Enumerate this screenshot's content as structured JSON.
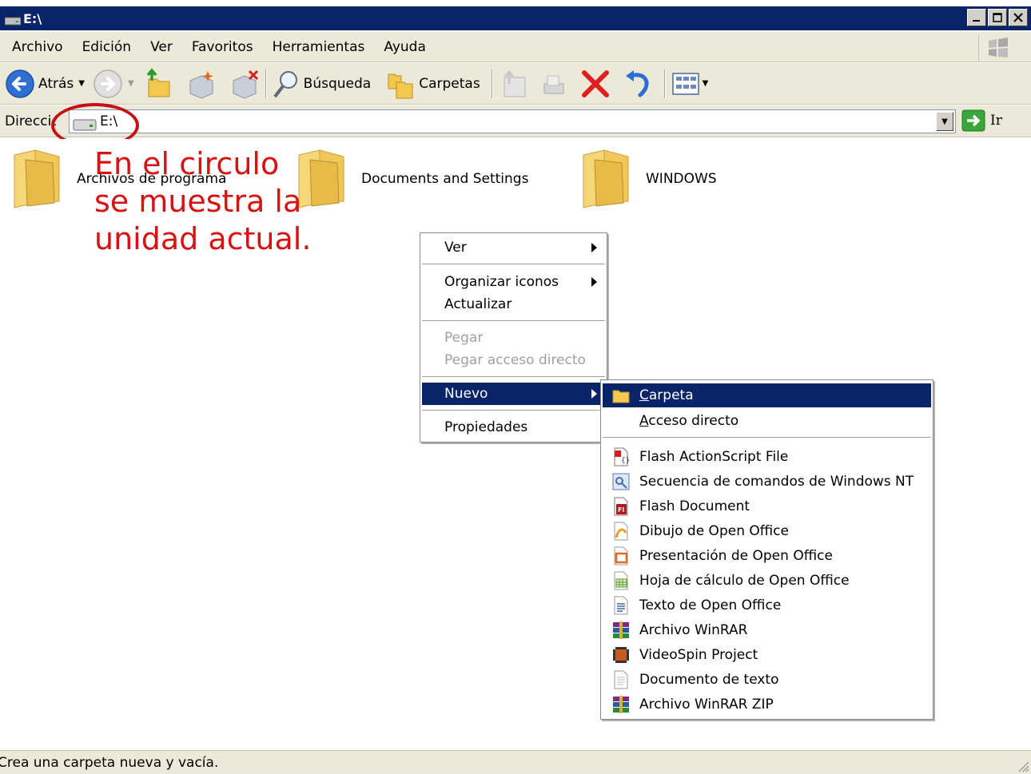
{
  "window": {
    "title": "E:\\"
  },
  "menubar": {
    "items": [
      "Archivo",
      "Edición",
      "Ver",
      "Favoritos",
      "Herramientas",
      "Ayuda"
    ]
  },
  "toolbar": {
    "back": "Atrás",
    "search": "Búsqueda",
    "folders": "Carpetas"
  },
  "address": {
    "label": "Dirección",
    "value": "E:\\",
    "go": "Ir"
  },
  "folders": [
    "Archivos de programa",
    "Documents and Settings",
    "WINDOWS"
  ],
  "annotation": {
    "lines": [
      "En el circulo",
      "se muestra la",
      "unidad actual."
    ]
  },
  "context_menu": {
    "items": [
      "Ver",
      "Organizar iconos",
      "Actualizar",
      "Pegar",
      "Pegar acceso directo",
      "Nuevo",
      "Propiedades"
    ]
  },
  "new_submenu": {
    "folder_prefix": "C",
    "folder_rest": "arpeta",
    "shortcut_prefix": "A",
    "shortcut_rest": "cceso directo",
    "items": [
      {
        "label": "Flash ActionScript File",
        "icon": "actionscript-file-icon"
      },
      {
        "label": "Secuencia de comandos de Windows NT",
        "icon": "script-file-icon"
      },
      {
        "label": "Flash Document",
        "icon": "flash-document-icon"
      },
      {
        "label": "Dibujo de Open Office",
        "icon": "openoffice-draw-icon"
      },
      {
        "label": "Presentación de Open Office",
        "icon": "openoffice-impress-icon"
      },
      {
        "label": "Hoja de cálculo de Open Office",
        "icon": "openoffice-calc-icon"
      },
      {
        "label": "Texto de Open Office",
        "icon": "openoffice-writer-icon"
      },
      {
        "label": "Archivo WinRAR",
        "icon": "winrar-icon"
      },
      {
        "label": "VideoSpin Project",
        "icon": "videospin-icon"
      },
      {
        "label": "Documento de texto",
        "icon": "text-document-icon"
      },
      {
        "label": "Archivo WinRAR ZIP",
        "icon": "winrar-zip-icon"
      }
    ]
  },
  "status": {
    "text": "Crea una carpeta nueva y vacía."
  },
  "colors": {
    "titlebar": "#0a246a",
    "selection": "#0a246a",
    "annotation": "#d81212",
    "chrome": "#ece9d8"
  }
}
